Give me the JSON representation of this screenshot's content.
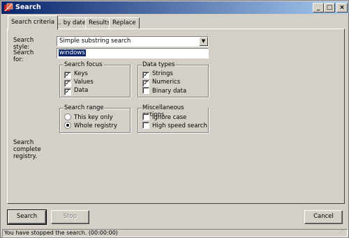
{
  "window": {
    "title": "Search"
  },
  "tabs": [
    "Search criteria",
    "... by date",
    "Results",
    "Replace"
  ],
  "search_style": {
    "label": "Search style:",
    "value": "Simple substring search"
  },
  "search_for": {
    "label": "Search for:",
    "value": "windows"
  },
  "search_focus": {
    "title": "Search focus",
    "items": [
      "Keys",
      "Values",
      "Data"
    ],
    "checked": [
      true,
      true,
      true
    ]
  },
  "data_types": {
    "title": "Data types",
    "items": [
      "Strings",
      "Numerics",
      "Binary data"
    ],
    "checked": [
      true,
      true,
      false
    ]
  },
  "search_range": {
    "title": "Search range",
    "items": [
      "This key only",
      "Whole registry"
    ],
    "selected": 1
  },
  "misc": {
    "title": "Miscellaneous options",
    "items": [
      "Ignore case",
      "High speed search"
    ],
    "checked": [
      false,
      false
    ]
  },
  "summary": "Search complete registry.",
  "buttons": {
    "search": "Search",
    "stop": "Stop",
    "cancel": "Cancel"
  },
  "status": "You have stopped the search. (00:00:00)"
}
